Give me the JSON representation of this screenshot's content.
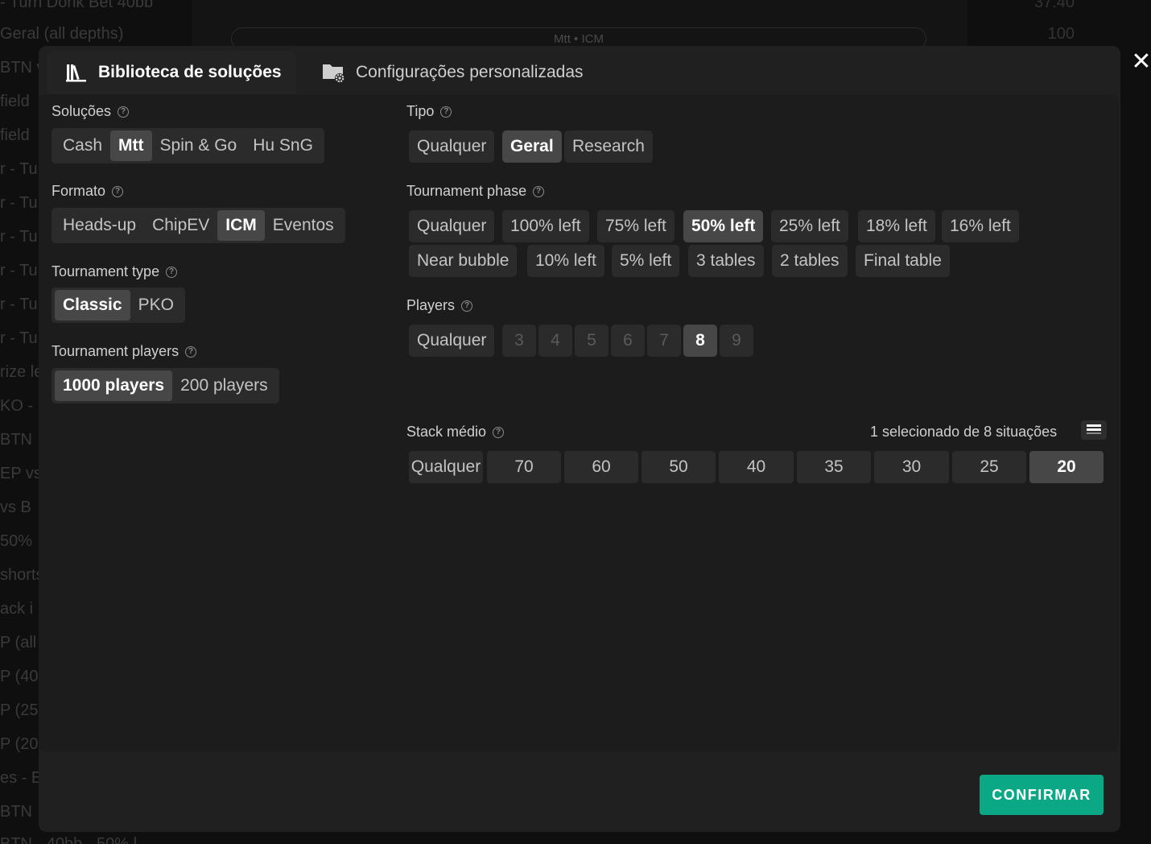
{
  "background": {
    "left_rows": [
      "- Turn Donk Bet 40bb",
      "Geral (all depths)",
      "BTN vs",
      "field",
      "field",
      "r - Tu",
      "r - Tu",
      "r - Tu",
      "r - Tu",
      "r - Tu",
      "r - Tu",
      "rize le",
      "KO -",
      "BTN",
      "EP vs",
      "vs B",
      "50%",
      "shorts",
      "ack i",
      "P (all",
      "P (40",
      "P (25",
      "P (20",
      "es - E",
      "BTN",
      "BTN - 40bb - 50% l"
    ],
    "pill_text": "Mtt • ICM",
    "right_values": [
      "37.40",
      "100"
    ]
  },
  "tabs": {
    "active": {
      "label": "Biblioteca de soluções",
      "icon": "books-icon"
    },
    "inactive": {
      "label": "Configurações personalizadas",
      "icon": "folder-settings-icon"
    }
  },
  "close_label": "✕",
  "help_glyph": "?",
  "left": {
    "solucoes": {
      "label": "Soluções",
      "options": [
        "Cash",
        "Mtt",
        "Spin & Go",
        "Hu SnG"
      ],
      "selected": "Mtt"
    },
    "formato": {
      "label": "Formato",
      "options": [
        "Heads-up",
        "ChipEV",
        "ICM",
        "Eventos"
      ],
      "selected": "ICM"
    },
    "tournament_type": {
      "label": "Tournament type",
      "options": [
        "Classic",
        "PKO"
      ],
      "selected": "Classic"
    },
    "tournament_players": {
      "label": "Tournament players",
      "options": [
        "1000 players",
        "200 players"
      ],
      "selected": "1000 players"
    }
  },
  "right": {
    "tipo": {
      "label": "Tipo",
      "options": [
        "Qualquer",
        "Geral",
        "Research"
      ],
      "selected": "Geral"
    },
    "phase": {
      "label": "Tournament phase",
      "row1": [
        "Qualquer",
        "100% left",
        "75% left",
        "50% left",
        "25% left",
        "18% left",
        "16% left"
      ],
      "row2": [
        "Near bubble",
        "10% left",
        "5% left",
        "3 tables",
        "2 tables",
        "Final table"
      ],
      "selected": "50% left"
    },
    "players": {
      "label": "Players",
      "options": [
        "Qualquer",
        "3",
        "4",
        "5",
        "6",
        "7",
        "8",
        "9"
      ],
      "selected": "8"
    },
    "stack": {
      "label": "Stack médio",
      "selection_text": "1 selecionado de 8 situações",
      "options": [
        "Qualquer",
        "70",
        "60",
        "50",
        "40",
        "35",
        "30",
        "25",
        "20"
      ],
      "selected": "20"
    }
  },
  "confirm_label": "CONFIRMAR",
  "colors": {
    "accent": "#0aa885",
    "selected_bg": "#474747",
    "chip_bg": "#2b2b2b",
    "modal_bg": "#202020"
  }
}
